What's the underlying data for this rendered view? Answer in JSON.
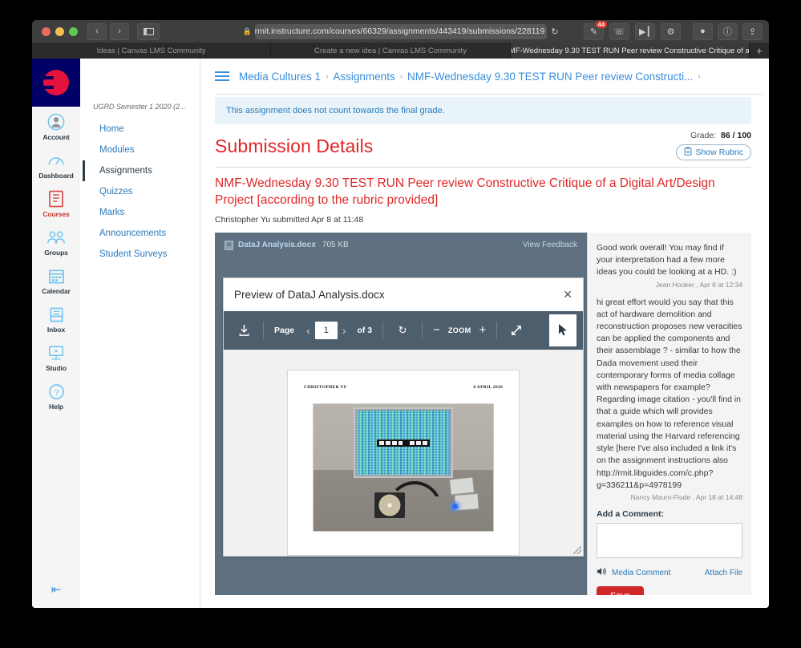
{
  "browser": {
    "url": "rmit.instructure.com/courses/66329/assignments/443419/submissions/228119",
    "lock_icon": "lock-icon",
    "reload_icon": "reload-icon",
    "back_icon": "‹",
    "forward_icon": "›",
    "badge_count": "44",
    "tabs": [
      {
        "label": "Ideas | Canvas LMS Community",
        "active": false
      },
      {
        "label": "Create a new idea | Canvas LMS Community",
        "active": false
      },
      {
        "label": "NMF-Wednesday 9.30 TEST RUN Peer review Constructive Critique of a...",
        "active": true
      }
    ],
    "new_tab_label": "+"
  },
  "global_nav": {
    "items": [
      {
        "label": "Account",
        "icon": "account-avatar-icon"
      },
      {
        "label": "Dashboard",
        "icon": "dashboard-gauge-icon"
      },
      {
        "label": "Courses",
        "icon": "courses-book-icon"
      },
      {
        "label": "Groups",
        "icon": "groups-people-icon"
      },
      {
        "label": "Calendar",
        "icon": "calendar-icon"
      },
      {
        "label": "Inbox",
        "icon": "inbox-tray-icon"
      },
      {
        "label": "Studio",
        "icon": "studio-screen-icon"
      },
      {
        "label": "Help",
        "icon": "help-question-icon"
      }
    ],
    "collapse_icon": "collapse-arrow-icon"
  },
  "course_nav": {
    "term": "UGRD Semester 1 2020 (2...",
    "items": [
      {
        "label": "Home",
        "active": false
      },
      {
        "label": "Modules",
        "active": false
      },
      {
        "label": "Assignments",
        "active": true
      },
      {
        "label": "Quizzes",
        "active": false
      },
      {
        "label": "Marks",
        "active": false
      },
      {
        "label": "Announcements",
        "active": false
      },
      {
        "label": "Student Surveys",
        "active": false
      }
    ]
  },
  "breadcrumb": {
    "menu_icon": "hamburger-menu-icon",
    "items": [
      "Media Cultures 1",
      "Assignments",
      "NMF-Wednesday 9.30 TEST RUN Peer review Constructi..."
    ],
    "separator": "›"
  },
  "main": {
    "notice": "This assignment does not count towards the final grade.",
    "page_title": "Submission Details",
    "grade_label": "Grade:",
    "grade_value": "86 / 100",
    "show_rubric_label": "Show Rubric",
    "rubric_icon": "clipboard-icon",
    "assignment_title": "NMF-Wednesday 9.30 TEST RUN Peer review Constructive Critique of a Digital Art/Design Project [according to the rubric provided]",
    "submitted_meta": "Christopher Yu submitted Apr 8 at 11:48"
  },
  "preview": {
    "file_icon": "word-doc-icon",
    "file_name": "DataJ Analysis.docx",
    "file_size": "705 KB",
    "view_feedback_label": "View Feedback",
    "modal_title": "Preview of DataJ Analysis.docx",
    "close_icon": "close-icon",
    "toolbar": {
      "download_icon": "download-icon",
      "page_label": "Page",
      "prev_icon": "chevron-left-icon",
      "page_value": "1",
      "next_icon": "chevron-right-icon",
      "of_label": "of 3",
      "rotate_icon": "rotate-icon",
      "minus_icon": "zoom-out-icon",
      "zoom_label": "ZOOM",
      "plus_icon": "zoom-in-icon",
      "fullscreen_icon": "fullscreen-expand-icon",
      "cursor_icon": "cursor-pointer-icon"
    },
    "document": {
      "header_left": "CHRISTOPHER YU",
      "header_right": "8 APRIL 2020"
    }
  },
  "comments": {
    "list": [
      {
        "text": "Good work overall! You may find if your interpretation had a few more ideas you could be looking at a HD. :)",
        "author": "Jean Hooker , Apr 8 at 12:34"
      },
      {
        "text": "hi great effort would you say that this act of hardware demolition and reconstruction proposes new veracities can be applied the components and their assemblage ? - similar to how the Dada movement used their contemporary forms of media collage with newspapers for example? Regarding image citation -  you'll find in that a guide which will provides examples on how to reference visual material using the Harvard referencing style [here I've also included a link it's on the assignment instructions also http://rmit.libguides.com/c.php?g=336211&p=4978199",
        "author": "Nancy Mauro-Flude , Apr 18 at 14:48"
      }
    ],
    "add_label": "Add a Comment:",
    "textarea_value": "",
    "textarea_placeholder": "",
    "media_comment_label": "Media Comment",
    "media_icon": "speaker-icon",
    "attach_file_label": "Attach File",
    "save_label": "Save"
  },
  "colors": {
    "canvas_red": "#e02727",
    "link_blue": "#2b7abc",
    "toolbar_slate": "#4d5e6c",
    "preview_bg": "#5f7180",
    "save_red": "#cf2626"
  }
}
